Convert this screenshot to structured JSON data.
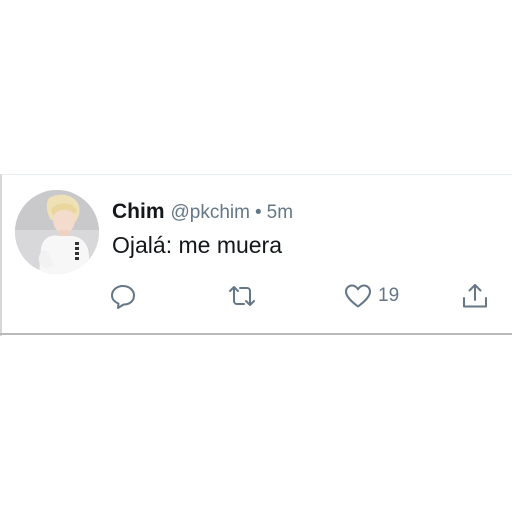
{
  "tweet": {
    "display_name": "Chim",
    "handle": "@pkchim",
    "separator": "•",
    "time": "5m",
    "text": "Ojalá: me muera",
    "like_count": "19"
  },
  "icons": {
    "reply": "reply-icon",
    "retweet": "retweet-icon",
    "like": "heart-icon",
    "share": "share-icon"
  },
  "colors": {
    "text_primary": "#14171a",
    "text_secondary": "#657786"
  }
}
